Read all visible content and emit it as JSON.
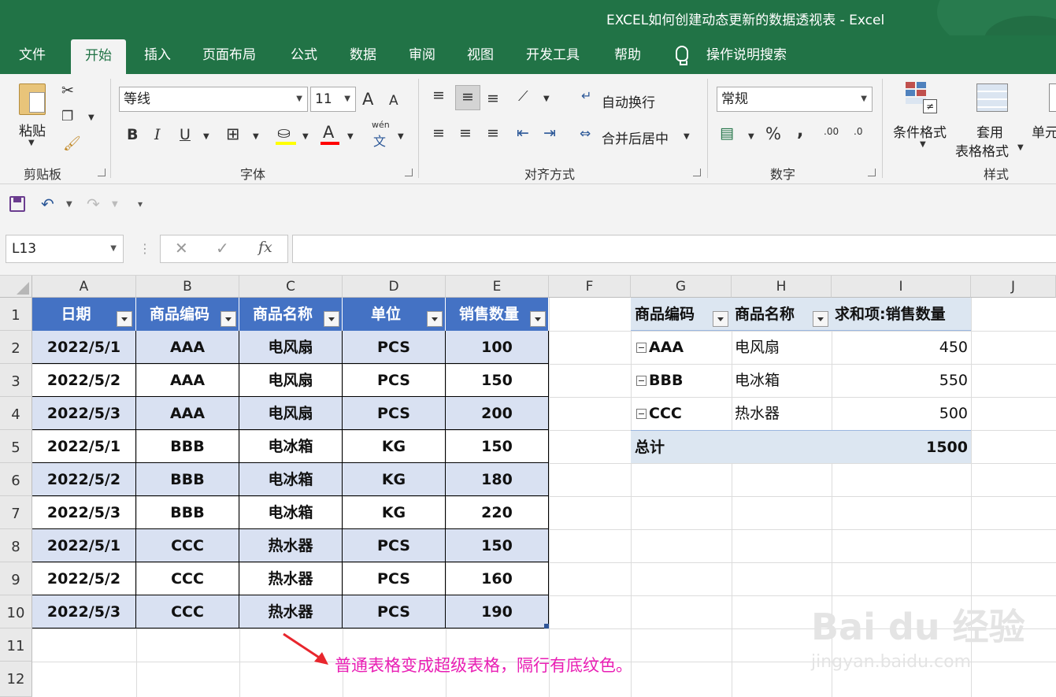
{
  "window": {
    "title": "EXCEL如何创建动态更新的数据透视表  -  Excel"
  },
  "tabs": [
    {
      "label": "文件"
    },
    {
      "label": "开始"
    },
    {
      "label": "插入"
    },
    {
      "label": "页面布局"
    },
    {
      "label": "公式"
    },
    {
      "label": "数据"
    },
    {
      "label": "审阅"
    },
    {
      "label": "视图"
    },
    {
      "label": "开发工具"
    },
    {
      "label": "帮助"
    }
  ],
  "tell_me": "操作说明搜索",
  "ribbon": {
    "clipboard": {
      "paste": "粘贴",
      "label": "剪贴板"
    },
    "font": {
      "name": "等线",
      "size": "11",
      "label": "字体",
      "bold": "B",
      "italic": "I",
      "underline": "U",
      "grow": "A",
      "shrink": "A",
      "color_a": "A",
      "phonetic_top": "wén",
      "phonetic_bottom": "文"
    },
    "alignment": {
      "wrap": "自动换行",
      "merge": "合并后居中",
      "label": "对齐方式"
    },
    "number": {
      "format": "常规",
      "percent": "%",
      "comma": ",",
      "inc_dec": ".00",
      "dec_dec": ".0",
      "label": "数字"
    },
    "styles": {
      "conditional": "条件格式",
      "table_top": "套用",
      "table_bottom": "表格格式",
      "cell": "单元",
      "label": "样式"
    }
  },
  "namebox": "L13",
  "formula_fx": "fx",
  "columns": [
    "A",
    "B",
    "C",
    "D",
    "E",
    "F",
    "G",
    "H",
    "I",
    "J"
  ],
  "rows": [
    "1",
    "2",
    "3",
    "4",
    "5",
    "6",
    "7",
    "8",
    "9",
    "10",
    "11",
    "12"
  ],
  "table": {
    "headers": [
      "日期",
      "商品编码",
      "商品名称",
      "单位",
      "销售数量"
    ],
    "rows": [
      [
        "2022/5/1",
        "AAA",
        "电风扇",
        "PCS",
        "100"
      ],
      [
        "2022/5/2",
        "AAA",
        "电风扇",
        "PCS",
        "150"
      ],
      [
        "2022/5/3",
        "AAA",
        "电风扇",
        "PCS",
        "200"
      ],
      [
        "2022/5/1",
        "BBB",
        "电冰箱",
        "KG",
        "150"
      ],
      [
        "2022/5/2",
        "BBB",
        "电冰箱",
        "KG",
        "180"
      ],
      [
        "2022/5/3",
        "BBB",
        "电冰箱",
        "KG",
        "220"
      ],
      [
        "2022/5/1",
        "CCC",
        "热水器",
        "PCS",
        "150"
      ],
      [
        "2022/5/2",
        "CCC",
        "热水器",
        "PCS",
        "160"
      ],
      [
        "2022/5/3",
        "CCC",
        "热水器",
        "PCS",
        "190"
      ]
    ]
  },
  "pivot": {
    "headers": [
      "商品编码",
      "商品名称",
      "求和项:销售数量"
    ],
    "rows": [
      [
        "AAA",
        "电风扇",
        "450"
      ],
      [
        "BBB",
        "电冰箱",
        "550"
      ],
      [
        "CCC",
        "热水器",
        "500"
      ]
    ],
    "total_label": "总计",
    "total_value": "1500"
  },
  "annotation": "普通表格变成超级表格，隔行有底纹色。",
  "watermark": {
    "main": "Bai du 经验",
    "sub": "jingyan.baidu.com"
  },
  "colors": {
    "excel_green": "#217346",
    "table_header": "#4472c4",
    "band": "#d9e1f2",
    "annotation": "#e91eb4"
  }
}
